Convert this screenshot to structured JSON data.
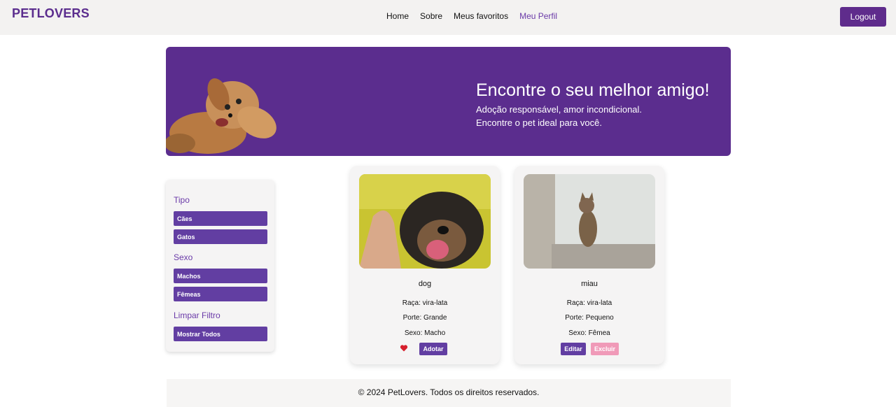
{
  "header": {
    "logo": "PETLOVERS",
    "nav": [
      "Home",
      "Sobre",
      "Meus favoritos",
      "Meu Perfil"
    ],
    "logout_label": "Logout"
  },
  "hero": {
    "title": "Encontre o seu melhor amigo!",
    "subtitle_line1": "Adoção responsável, amor incondicional.",
    "subtitle_line2": "Encontre o pet ideal para você."
  },
  "filters": {
    "tipo_heading": "Tipo",
    "tipo_options": [
      "Cães",
      "Gatos"
    ],
    "sexo_heading": "Sexo",
    "sexo_options": [
      "Machos",
      "Fêmeas"
    ],
    "limpar_heading": "Limpar Filtro",
    "show_all_label": "Mostrar Todos"
  },
  "pets": [
    {
      "name": "dog",
      "raca": "Raça: vira-lata",
      "porte": "Porte: Grande",
      "sexo": "Sexo: Macho",
      "action_label": "Adotar"
    },
    {
      "name": "miau",
      "raca": "Raça: vira-lata",
      "porte": "Porte: Pequeno",
      "sexo": "Sexo: Fêmea",
      "edit_label": "Editar",
      "delete_label": "Excluir"
    }
  ],
  "footer": {
    "text": "© 2024 PetLovers. Todos os direitos reservados."
  },
  "colors": {
    "brand": "#5b2d8e",
    "button": "#623ea2",
    "delete": "#f09ab8",
    "heart": "#d61f2c"
  }
}
